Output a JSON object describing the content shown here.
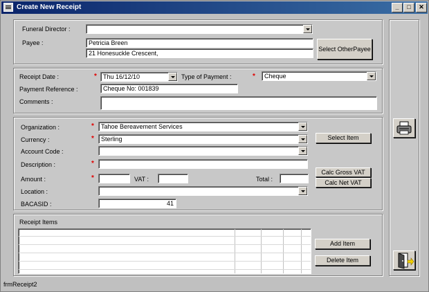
{
  "window": {
    "title": "Create New Receipt",
    "status": "frmReceipt2"
  },
  "payee_section": {
    "funeral_director_label": "Funeral Director :",
    "funeral_director_value": "",
    "payee_label": "Payee :",
    "payee_name": "Petricia Breen",
    "payee_address": "21 Honesuckle Crescent,",
    "select_other_payee": "Select OtherPayee"
  },
  "receipt_section": {
    "receipt_date_label": "Receipt Date :",
    "receipt_date_value": "Thu 16/12/10",
    "payment_type_label": "Type of Payment :",
    "payment_type_value": "Cheque",
    "payment_reference_label": "Payment Reference :",
    "payment_reference_value": "Cheque No: 001839",
    "comments_label": "Comments :",
    "comments_value": ""
  },
  "item_section": {
    "organization_label": "Organization :",
    "organization_value": "Tahoe Bereavement Services",
    "currency_label": "Currency :",
    "currency_value": "Sterling",
    "account_code_label": "Account Code :",
    "account_code_value": "",
    "description_label": "Description :",
    "description_value": "",
    "amount_label": "Amount :",
    "amount_value": "",
    "vat_label": "VAT :",
    "vat_value": "",
    "total_label": "Total :",
    "total_value": "",
    "location_label": "Location :",
    "location_value": "",
    "bacasid_label": "BACASID :",
    "bacasid_value": "41",
    "select_item": "Select Item",
    "calc_gross_vat": "Calc Gross VAT",
    "calc_net_vat": "Calc Net VAT",
    "required_mark": "*"
  },
  "items_section": {
    "title": "Receipt Items",
    "add_item": "Add Item",
    "delete_item": "Delete Item"
  },
  "icons": {
    "print": "printer-icon",
    "exit": "exit-door-icon"
  }
}
